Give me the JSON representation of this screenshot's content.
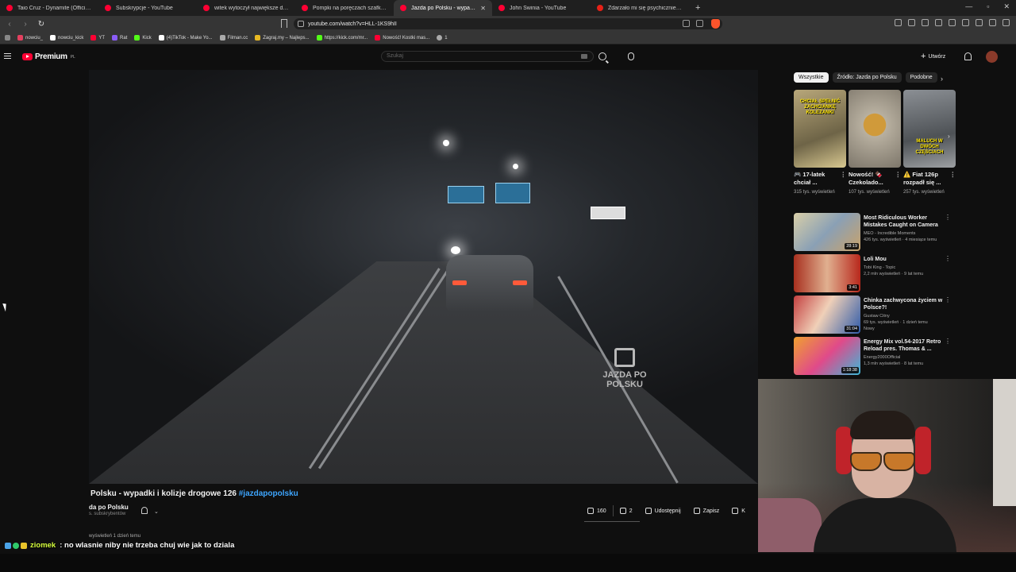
{
  "browser": {
    "tabs": [
      {
        "label": "Taio Cruz - Dynamite (Official Video)",
        "active": false
      },
      {
        "label": "Subskrypcje - YouTube",
        "active": false
      },
      {
        "label": "witek wytoczył największe działo - Yo",
        "active": false
      },
      {
        "label": "Pompki na poręczach szafka na głow",
        "active": false
      },
      {
        "label": "Jazda po Polsku - wypadki i",
        "active": true
      },
      {
        "label": "John Świnia - YouTube",
        "active": false
      },
      {
        "label": "Zdarzało mi się psychicznie zniszczć",
        "active": false
      }
    ],
    "new_tab": "+",
    "url": "youtube.com/watch?v=HLL-1KS9hII",
    "bookmarks": [
      {
        "label": "nowciu_",
        "color": "#e4405f"
      },
      {
        "label": "nowciu_kick",
        "color": "#ffffff"
      },
      {
        "label": "YT",
        "color": "#ff0033"
      },
      {
        "label": "Rat",
        "color": "#8a5cf6"
      },
      {
        "label": "Kick",
        "color": "#53fc18"
      },
      {
        "label": "(4)TikTok - Make Yo...",
        "color": "#ffffff"
      },
      {
        "label": "Filman.cc",
        "color": "#aaaaaa"
      },
      {
        "label": "Zagraj.my – Najleps...",
        "color": "#e8b923"
      },
      {
        "label": "https://kick.com/mr...",
        "color": "#53fc18"
      },
      {
        "label": "Nowość! Kostki mas...",
        "color": "#ff0033"
      },
      {
        "label": "1",
        "color": "#aaaaaa"
      }
    ]
  },
  "youtube": {
    "logo": "Premium",
    "logo_region": "PL",
    "search_placeholder": "Szukaj",
    "create_label": "Utwórz",
    "accent": "#ff0033"
  },
  "video": {
    "title": "Polsku - wypadki i kolizje drogowe 126",
    "hashtag": "#jazdapopolsku",
    "channel": "da po Polsku",
    "subs": "s. subskrybentów",
    "likes": "160",
    "dislikes": "2",
    "share": "Udostępnij",
    "save": "Zapisz",
    "clip": "K",
    "views": "wyświetleń  1 dzień temu",
    "watermark_line1": "JAZDA PO",
    "watermark_line2": "POLSKU"
  },
  "chips": [
    "Wszystkie",
    "Źródło: Jazda po Polsku",
    "Podobne"
  ],
  "shorts": [
    {
      "overlay": "CHCIAŁ SPEŁNIĆ ZACHCIANKĘ KOLEŻANKI",
      "title": "🎮 17-latek chciał ...",
      "views": "315 tys. wyświetleń",
      "bg": "#8d7f5c"
    },
    {
      "overlay": "",
      "title": "Nowość! 🍫 Czekolado...",
      "views": "107 tys. wyświetleń",
      "bg": "#a79a7c"
    },
    {
      "overlay": "MALUCH W DWÓCH CZĘŚCIACH",
      "title": "⚠️ Fiat 126p rozpadł się ...",
      "views": "257 tys. wyświetleń",
      "bg": "#6b6e73"
    }
  ],
  "recommendations": [
    {
      "title": "Most Ridiculous Worker Mistakes Caught on Camera",
      "channel": "MEO - Incredible Moments",
      "meta": "426 tys. wyświetleń · 4 miesiące temu",
      "duration": "28:19",
      "bg": "#c4b48e",
      "extra": ""
    },
    {
      "title": "Loli Mou",
      "channel": "Tobi King - Topic",
      "meta": "2,2 mln wyświetleń · 9 lat temu",
      "duration": "3:41",
      "bg": "#c23c2a",
      "extra": ""
    },
    {
      "title": "Chinka zachwycona życiem w Polsce?!",
      "channel": "Gustaw Citny",
      "meta": "69 tys. wyświetleń · 1 dzień temu",
      "duration": "31:04",
      "bg": "#8a3b3b",
      "extra": "Nowy"
    },
    {
      "title": "Energy Mix vol.54-2017 Retro Reload pres. Thomas & ...",
      "channel": "Energy2000Official",
      "meta": "1,3 mln wyświetleń · 8 lat temu",
      "duration": "1:18:38",
      "bg": "#e0732a",
      "extra": ""
    }
  ],
  "chat": {
    "user": "ziomek",
    "message": ": no wlasnie niby nie trzeba chuj wie jak to dziala"
  }
}
